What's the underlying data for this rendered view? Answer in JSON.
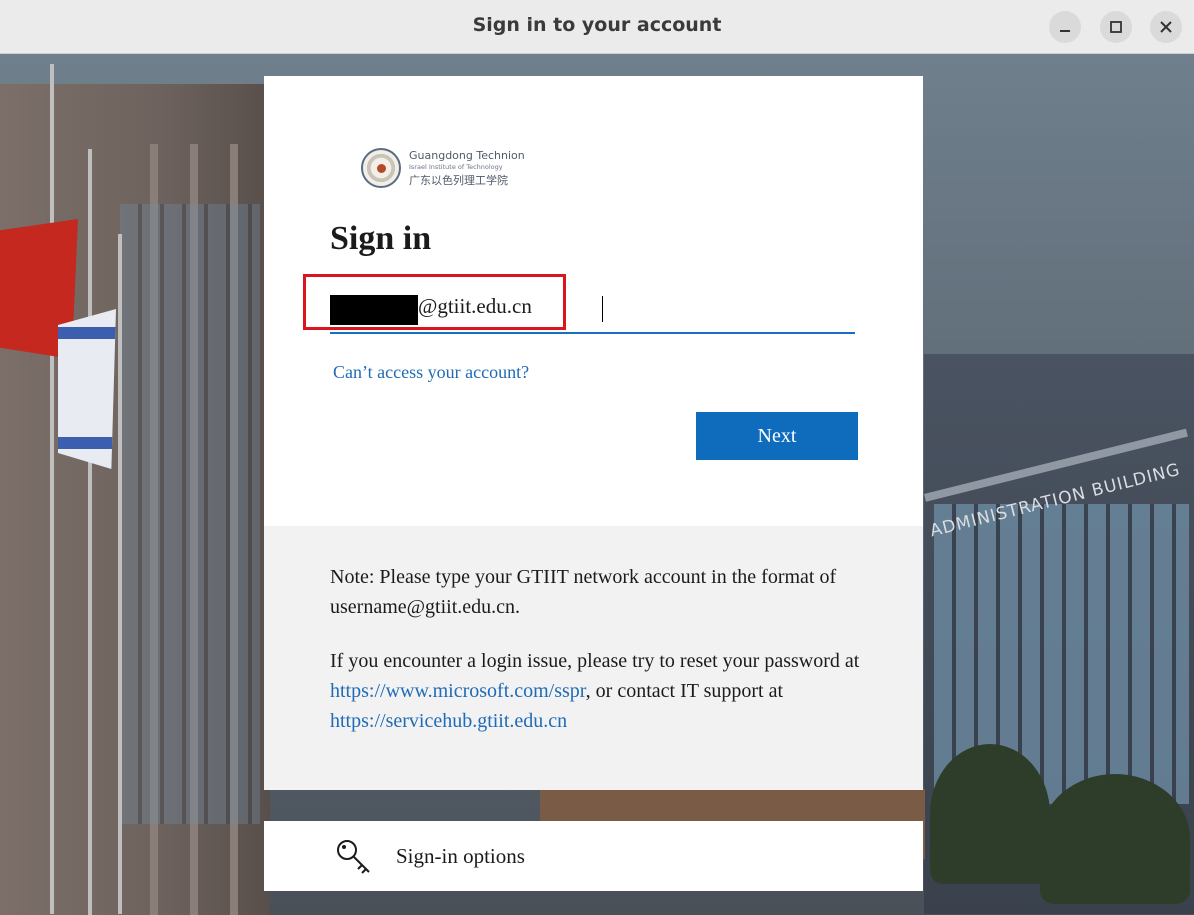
{
  "window": {
    "title": "Sign in to your account",
    "controls": [
      "minimize-icon",
      "maximize-icon",
      "close-icon"
    ]
  },
  "background": {
    "building_sign": "ADMINISTRATION BUILDING"
  },
  "logo": {
    "name_en": "Guangdong Technion",
    "subtitle": "Israel Institute of Technology",
    "name_cn": "广东以色列理工学院"
  },
  "signin": {
    "heading": "Sign in",
    "email_value": "@gtiit.edu.cn",
    "cant_access": "Can’t access your account?",
    "next_label": "Next"
  },
  "note": {
    "line1": "Note: Please type your GTIIT network account in the format of username@gtiit.edu.cn.",
    "p2_before": "If you encounter a login issue, please try to reset your password at ",
    "link_sspr": "https://www.microsoft.com/sspr",
    "p2_middle": ", or contact IT support at ",
    "link_servicehub": "https://servicehub.gtiit.edu.cn"
  },
  "options": {
    "label": "Sign-in options",
    "icon": "key-icon"
  },
  "colors": {
    "accent": "#0f6cbd",
    "link": "#1f6bb5",
    "highlight": "#d9161d"
  }
}
